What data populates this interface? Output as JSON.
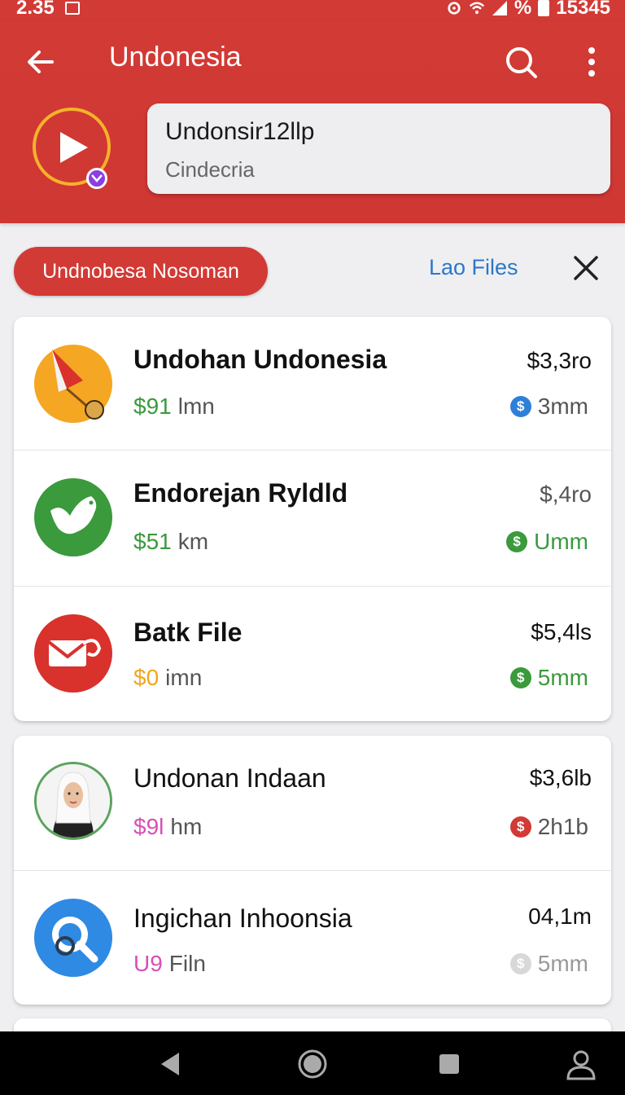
{
  "status_bar": {
    "time": "2.35",
    "right_text": "15345",
    "percent": "%"
  },
  "app_bar": {
    "title": "Undonesia"
  },
  "account": {
    "name": "Undonsir12llp",
    "subtitle": "Cindecria"
  },
  "filter_chip": {
    "label": "Undnobesa Nosoman"
  },
  "action_link": {
    "label": "Lao Files"
  },
  "colors": {
    "primary": "#d23a35",
    "link": "#2b78c9",
    "accent_yellow": "#f5b22a",
    "green": "#3a9a3c",
    "purple_badge": "#8a3fe0"
  },
  "list": [
    {
      "name": "Undohan Undonesia",
      "bold": true,
      "sub_value": "$91",
      "sub_value_color": "#3a9a3c",
      "sub_unit": "lmn",
      "amount": "$3,3ro",
      "meta": "3mm",
      "meta_color": "#555555",
      "coin_color": "#2e7fd9",
      "icon": "map-marker-flag-icon"
    },
    {
      "name": "Endorejan Ryldld",
      "bold": true,
      "sub_value": "$51",
      "sub_value_color": "#3a9a3c",
      "sub_unit": "km",
      "amount": "$,4ro",
      "meta": "Umm",
      "meta_color": "#3a9a3c",
      "coin_color": "#3a9a3c",
      "icon": "bird-icon"
    },
    {
      "name": "Batk File",
      "bold": true,
      "sub_value": "$0",
      "sub_value_color": "#f3a51e",
      "sub_unit": "imn",
      "amount": "$5,4ls",
      "meta": "5mm",
      "meta_color": "#3a9a3c",
      "coin_color": "#3a9a3c",
      "icon": "mail-icon"
    },
    {
      "name": "Undonan Indaan",
      "bold": false,
      "sub_value": "$9l",
      "sub_value_color": "#d84fb5",
      "sub_unit": "hm",
      "amount": "$3,6lb",
      "meta": "2h1b",
      "meta_color": "#555555",
      "coin_color": "#d23a35",
      "icon": "profile-photo"
    },
    {
      "name": "Ingichan Inhoonsia",
      "bold": false,
      "sub_value": "U9",
      "sub_value_color": "#d84fb5",
      "sub_unit": "Filn",
      "amount": "04,1m",
      "meta": "5mm",
      "meta_color": "#999999",
      "coin_color": "#d8d8d8",
      "icon": "key-search-icon"
    }
  ]
}
